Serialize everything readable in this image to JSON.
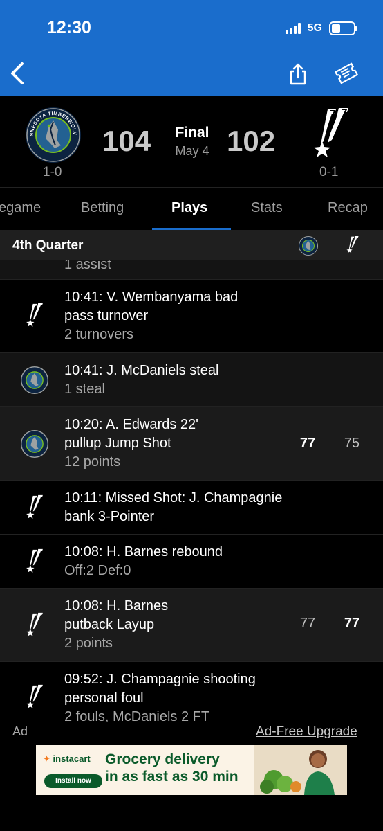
{
  "status_bar": {
    "time": "12:30",
    "network": "5G"
  },
  "game": {
    "home_team": {
      "logo_text": "MINNESOTA TIMBERWOLVES",
      "score": "104",
      "record": "1-0"
    },
    "away_team": {
      "score": "102",
      "record": "0-1"
    },
    "status": "Final",
    "date": "May 4"
  },
  "tabs": [
    {
      "label": "egame"
    },
    {
      "label": "Betting"
    },
    {
      "label": "Plays"
    },
    {
      "label": "Stats"
    },
    {
      "label": "Recap"
    }
  ],
  "active_tab": "Plays",
  "quarter": {
    "title": "4th Quarter"
  },
  "plays": [
    {
      "team": "home",
      "lines": [
        "1 assist"
      ],
      "partial": true
    },
    {
      "team": "away",
      "lines": [
        "10:41: V. Wembanyama bad",
        "pass turnover"
      ],
      "sub": "2 turnovers"
    },
    {
      "team": "home",
      "lines": [
        "10:41: J. McDaniels steal"
      ],
      "sub": "1 steal"
    },
    {
      "team": "home",
      "lines": [
        "10:20: A. Edwards 22'",
        "pullup Jump Shot"
      ],
      "sub": "12 points",
      "home_score": "77",
      "away_score": "75",
      "bold": "home"
    },
    {
      "team": "away",
      "lines": [
        "10:11: Missed Shot: J. Champagnie",
        "bank 3-Pointer"
      ]
    },
    {
      "team": "away",
      "lines": [
        "10:08: H. Barnes rebound"
      ],
      "sub": "Off:2 Def:0"
    },
    {
      "team": "away",
      "lines": [
        "10:08: H. Barnes",
        "putback Layup"
      ],
      "sub": "2 points",
      "home_score": "77",
      "away_score": "77",
      "bold": "away"
    },
    {
      "team": "away",
      "lines": [
        "09:52: J. Champagnie shooting",
        "personal foul"
      ],
      "sub": "2 fouls, McDaniels 2 FT"
    }
  ],
  "ad": {
    "label": "Ad",
    "upgrade": "Ad-Free Upgrade",
    "brand": "instacart",
    "install": "Install now",
    "headline_1": "Grocery delivery",
    "headline_2": "in as fast as 30 min"
  },
  "colors": {
    "nav_blue": "#1a6dcc",
    "header_bg": "#1f1f1f",
    "row_alt": "#141414",
    "instacart_green": "#0a5a2a",
    "instacart_orange": "#f37a1f"
  },
  "icons": {
    "back": "chevron-left-icon",
    "share": "share-icon",
    "ticket": "ticket-icon",
    "home_logo": "timberwolves-logo",
    "away_logo": "spurs-logo"
  }
}
